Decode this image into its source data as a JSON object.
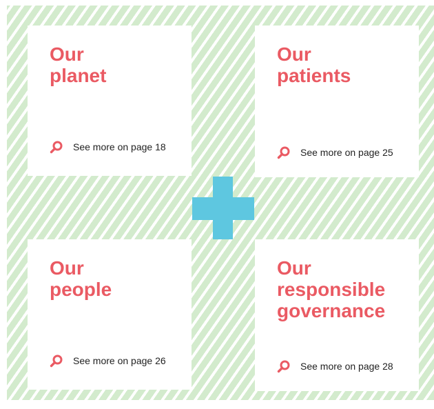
{
  "colors": {
    "accent": "#ea5a63",
    "stripe": "#d3ebcd",
    "plus": "#5ec7e0"
  },
  "cards": [
    {
      "title": "Our\nplanet",
      "link_label": "See more on page 18",
      "icon": "search-icon"
    },
    {
      "title": "Our\npatients",
      "link_label": "See more on page 25",
      "icon": "search-icon"
    },
    {
      "title": "Our\npeople",
      "link_label": "See more on page 26",
      "icon": "search-icon"
    },
    {
      "title": "Our\nresponsible\ngovernance",
      "link_label": "See more on page 28",
      "icon": "search-icon"
    }
  ],
  "center_icon": "plus-icon"
}
